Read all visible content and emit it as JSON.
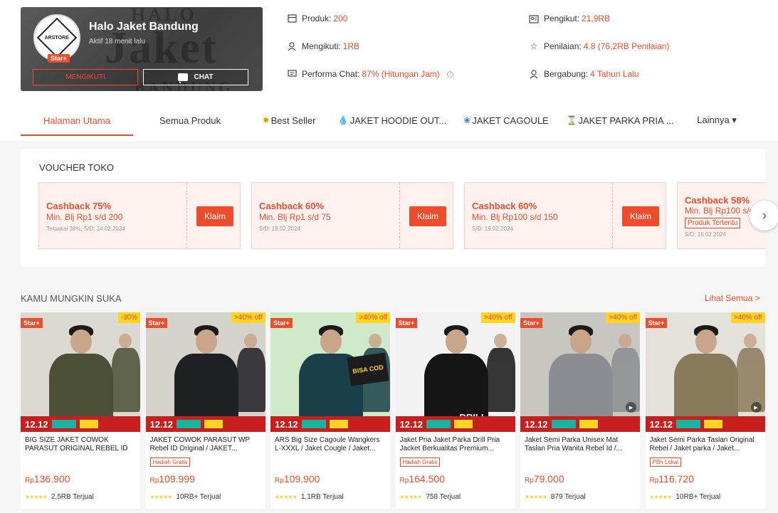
{
  "shop": {
    "name": "Halo Jaket Bandung",
    "active": "Aktif 18 menit lalu",
    "badge": "Star+",
    "avatar_text": "ARSTORE",
    "banner_word": "Jaket",
    "banner_top": "HALO",
    "banner_bottom": "BANDUNG",
    "follow_label": "MENGIKUTI",
    "chat_label": "CHAT"
  },
  "stats": [
    {
      "icon": "store-icon",
      "label": "Produk:",
      "value": "200"
    },
    {
      "icon": "user-icon",
      "label": "Mengikuti:",
      "value": "1RB"
    },
    {
      "icon": "chat-bubble-icon",
      "label": "Performa Chat:",
      "value": "87% (Hitungan Jam)"
    },
    {
      "icon": "followers-icon",
      "label": "Pengikut:",
      "value": "21,9RB"
    },
    {
      "icon": "star-outline-icon",
      "label": "Penilaian:",
      "value": "4.8 (76,2RB Penilaian)"
    },
    {
      "icon": "user-icon",
      "label": "Bergabung:",
      "value": "4 Tahun Lalu"
    }
  ],
  "tabs": [
    {
      "label": "Halaman Utama",
      "emoji": ""
    },
    {
      "label": "Semua Produk",
      "emoji": ""
    },
    {
      "label": "Best Seller",
      "emoji": "✸"
    },
    {
      "label": "JAKET HOODIE OUT...",
      "emoji": "💧"
    },
    {
      "label": "JAKET CAGOULE",
      "emoji": "❀"
    },
    {
      "label": "JAKET PARKA PRIA ...",
      "emoji": "⌛"
    },
    {
      "label": "Lainnya ▾",
      "emoji": ""
    }
  ],
  "voucher_section": {
    "title": "VOUCHER TOKO",
    "claim_label": "Klaim",
    "vouchers": [
      {
        "title": "Cashback 75%",
        "sub": "Min. Blj Rp1 s/d 200",
        "note": "Terpakai 38%, S/D: 14.02.2024",
        "tag": ""
      },
      {
        "title": "Cashback 60%",
        "sub": "Min. Blj Rp1 s/d 75",
        "note": "S/D: 19.02.2024",
        "tag": ""
      },
      {
        "title": "Cashback 60%",
        "sub": "Min. Blj Rp100 s/d 150",
        "note": "S/D: 19.02.2024",
        "tag": ""
      },
      {
        "title": "Cashback 58%",
        "sub": "Min. Blj Rp100 s/d",
        "note": "S/D: 16.02.2024",
        "tag": "Produk Tertentu"
      }
    ]
  },
  "products_section": {
    "title": "KAMU MUNGKIN SUKA",
    "see_all": "Lihat Semua >",
    "promo_date": "12.12",
    "items": [
      {
        "name": "BIG SIZE JAKET COWOK PARASUT ORIGINAL REBEL ID",
        "price": "136.900",
        "currency": "Rp",
        "sold": "2,5RB Terjual",
        "discount": "-30%",
        "tag": "",
        "badge": "Star+",
        "color": "#4a4f35",
        "bg": "#dcd8d2",
        "video": false
      },
      {
        "name": "JAKET COWOK PARASUT WP Rebel ID Original / JAKET...",
        "price": "109.999",
        "currency": "Rp",
        "sold": "10RB+ Terjual",
        "discount": ">40% off",
        "tag": "Hadiah Gratis",
        "badge": "Star+",
        "color": "#1e2023",
        "bg": "#d6d2cc",
        "video": false
      },
      {
        "name": "ARS Big Size Cagoule Wangkers L-XXXL / Jaket Cougle / Jaket...",
        "price": "109.900",
        "currency": "Rp",
        "sold": "1,1RB Terjual",
        "discount": ">40% off",
        "tag": "",
        "badge": "Star+",
        "color": "#1b3f48",
        "bg": "#cfe9c9",
        "video": false,
        "overlay": "BISA COD"
      },
      {
        "name": "Jaket Pria Jaket Parka Drill Pria Jacket Berkualitas Premium...",
        "price": "164.500",
        "currency": "Rp",
        "sold": "758 Terjual",
        "discount": ">40% off",
        "tag": "Hadiah Gratis",
        "badge": "Star+",
        "color": "#151515",
        "bg": "#f2f2f2",
        "video": false,
        "overlay": "DRILL"
      },
      {
        "name": "Jaket Semi Parka Unisex Mat Taslan Pria Wanita Rebel Id /...",
        "price": "79.000",
        "currency": "Rp",
        "sold": "879 Terjual",
        "discount": ">40% off",
        "tag": "",
        "badge": "Star+",
        "color": "#8b8d92",
        "bg": "#c9c5c0",
        "video": true
      },
      {
        "name": "Jaket Semi Parka Taslan Original Rebel / Jaket parka / Jaket...",
        "price": "116.720",
        "currency": "Rp",
        "sold": "10RB+ Terjual",
        "discount": ">40% off",
        "tag": "PBh Lokal",
        "badge": "Star+",
        "color": "#8a7a5c",
        "bg": "#e4e0da",
        "video": true
      }
    ]
  },
  "colors": {
    "accent": "#ee4d2d",
    "star": "#ffce3d",
    "promo": "#c81e1e"
  }
}
